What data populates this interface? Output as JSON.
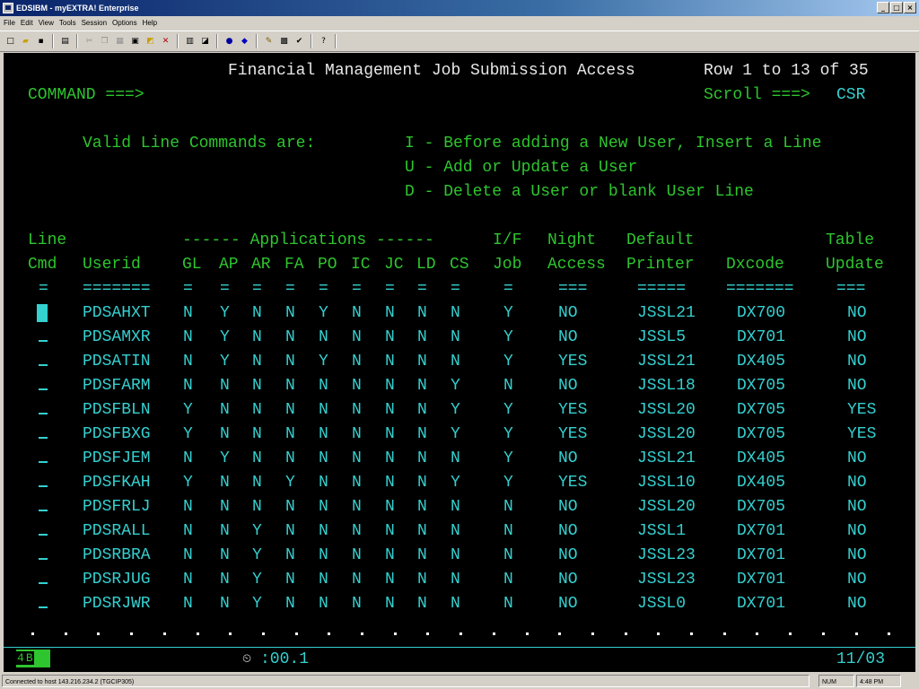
{
  "window": {
    "title": "EDSIBM - myEXTRA! Enterprise",
    "minimize": "_",
    "maximize": "□",
    "close": "×"
  },
  "menu": [
    "File",
    "Edit",
    "View",
    "Tools",
    "Session",
    "Options",
    "Help"
  ],
  "toolbar_icons": [
    "new-icon",
    "open-icon",
    "save-icon",
    "print-icon",
    "cut-icon",
    "copy-icon",
    "paste-icon",
    "page-icon",
    "macro-icon",
    "tools-icon",
    "connect-icon",
    "disconnect-icon",
    "record-icon",
    "color-icon",
    "edit-icon",
    "edit-icon",
    "edit-icon",
    "help-icon"
  ],
  "screen": {
    "title": "Financial Management Job Submission Access",
    "row_info": "Row 1 to 13 of 35",
    "command_label": "COMMAND ===>",
    "scroll_label": "Scroll ===>",
    "scroll_value": "CSR",
    "valid_label": "Valid Line Commands are:",
    "commands": [
      "I - Before adding a New User, Insert a Line",
      "U - Add or Update a User",
      "D - Delete a User or blank User Line"
    ]
  },
  "headers": {
    "line1": "Line",
    "apps_group": "------ Applications ------",
    "if1": "I/F",
    "night1": "Night",
    "default1": "Default",
    "table1": "Table",
    "cmd": "Cmd",
    "userid": "Userid",
    "apps": [
      "GL",
      "AP",
      "AR",
      "FA",
      "PO",
      "IC",
      "JC",
      "LD",
      "CS"
    ],
    "job": "Job",
    "access": "Access",
    "printer": "Printer",
    "dxcode": "Dxcode",
    "update": "Update"
  },
  "underlines": {
    "cmd": "=",
    "userid": "=======",
    "app": "=",
    "job": "=",
    "access": "===",
    "printer": "=====",
    "dxcode": "=======",
    "update": "==="
  },
  "rows": [
    {
      "userid": "PDSAHXT",
      "apps": [
        "N",
        "Y",
        "N",
        "N",
        "Y",
        "N",
        "N",
        "N",
        "N"
      ],
      "job": "Y",
      "access": "NO",
      "printer": "JSSL21",
      "dxcode": "DX700",
      "update": "NO"
    },
    {
      "userid": "PDSAMXR",
      "apps": [
        "N",
        "Y",
        "N",
        "N",
        "N",
        "N",
        "N",
        "N",
        "N"
      ],
      "job": "Y",
      "access": "NO",
      "printer": "JSSL5",
      "dxcode": "DX701",
      "update": "NO"
    },
    {
      "userid": "PDSATIN",
      "apps": [
        "N",
        "Y",
        "N",
        "N",
        "Y",
        "N",
        "N",
        "N",
        "N"
      ],
      "job": "Y",
      "access": "YES",
      "printer": "JSSL21",
      "dxcode": "DX405",
      "update": "NO"
    },
    {
      "userid": "PDSFARM",
      "apps": [
        "N",
        "N",
        "N",
        "N",
        "N",
        "N",
        "N",
        "N",
        "Y"
      ],
      "job": "N",
      "access": "NO",
      "printer": "JSSL18",
      "dxcode": "DX705",
      "update": "NO"
    },
    {
      "userid": "PDSFBLN",
      "apps": [
        "Y",
        "N",
        "N",
        "N",
        "N",
        "N",
        "N",
        "N",
        "Y"
      ],
      "job": "Y",
      "access": "YES",
      "printer": "JSSL20",
      "dxcode": "DX705",
      "update": "YES"
    },
    {
      "userid": "PDSFBXG",
      "apps": [
        "Y",
        "N",
        "N",
        "N",
        "N",
        "N",
        "N",
        "N",
        "Y"
      ],
      "job": "Y",
      "access": "YES",
      "printer": "JSSL20",
      "dxcode": "DX705",
      "update": "YES"
    },
    {
      "userid": "PDSFJEM",
      "apps": [
        "N",
        "Y",
        "N",
        "N",
        "N",
        "N",
        "N",
        "N",
        "N"
      ],
      "job": "Y",
      "access": "NO",
      "printer": "JSSL21",
      "dxcode": "DX405",
      "update": "NO"
    },
    {
      "userid": "PDSFKAH",
      "apps": [
        "Y",
        "N",
        "N",
        "Y",
        "N",
        "N",
        "N",
        "N",
        "Y"
      ],
      "job": "Y",
      "access": "YES",
      "printer": "JSSL10",
      "dxcode": "DX405",
      "update": "NO"
    },
    {
      "userid": "PDSFRLJ",
      "apps": [
        "N",
        "N",
        "N",
        "N",
        "N",
        "N",
        "N",
        "N",
        "N"
      ],
      "job": "N",
      "access": "NO",
      "printer": "JSSL20",
      "dxcode": "DX705",
      "update": "NO"
    },
    {
      "userid": "PDSRALL",
      "apps": [
        "N",
        "N",
        "Y",
        "N",
        "N",
        "N",
        "N",
        "N",
        "N"
      ],
      "job": "N",
      "access": "NO",
      "printer": "JSSL1",
      "dxcode": "DX701",
      "update": "NO"
    },
    {
      "userid": "PDSRBRA",
      "apps": [
        "N",
        "N",
        "Y",
        "N",
        "N",
        "N",
        "N",
        "N",
        "N"
      ],
      "job": "N",
      "access": "NO",
      "printer": "JSSL23",
      "dxcode": "DX701",
      "update": "NO"
    },
    {
      "userid": "PDSRJUG",
      "apps": [
        "N",
        "N",
        "Y",
        "N",
        "N",
        "N",
        "N",
        "N",
        "N"
      ],
      "job": "N",
      "access": "NO",
      "printer": "JSSL23",
      "dxcode": "DX701",
      "update": "NO"
    },
    {
      "userid": "PDSRJWR",
      "apps": [
        "N",
        "N",
        "Y",
        "N",
        "N",
        "N",
        "N",
        "N",
        "N"
      ],
      "job": "N",
      "access": "NO",
      "printer": "JSSL0",
      "dxcode": "DX701",
      "update": "NO"
    }
  ],
  "oia": {
    "session_num": "4",
    "session_letter": "B",
    "timer_icon": "clock-icon",
    "timer": ":00.1",
    "cursor_pos": "11/03"
  },
  "status": {
    "connection": "Connected to host 143.216.234.2 (TGCIP305)",
    "num": "NUM",
    "time": "4:48 PM"
  },
  "colors": {
    "terminal_bg": "#000000",
    "white_text": "#e8e8e8",
    "green_text": "#2ec52e",
    "cyan_text": "#35d0d0"
  }
}
